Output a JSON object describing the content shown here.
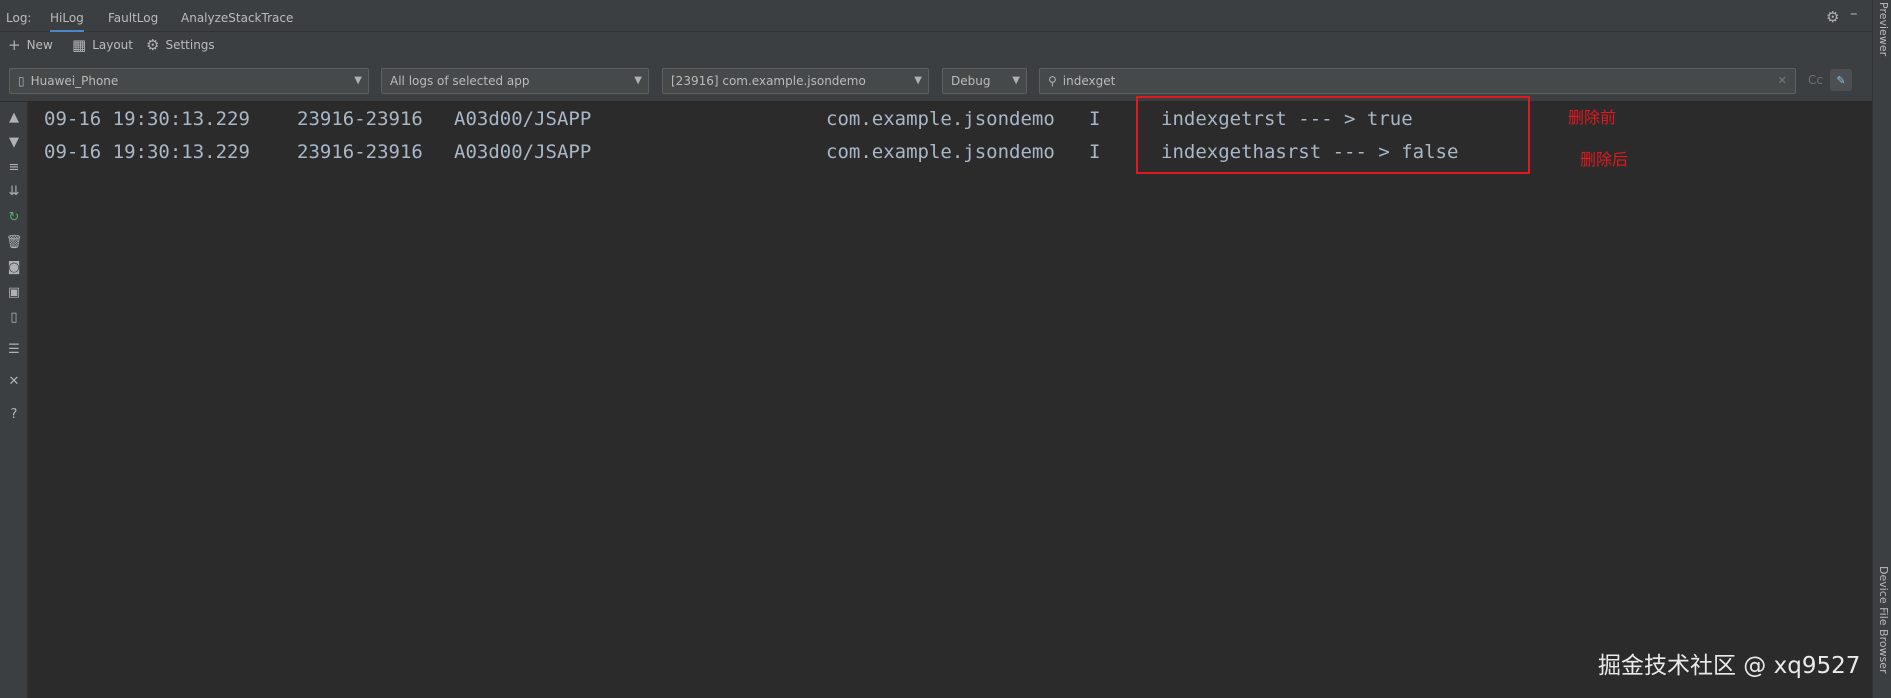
{
  "topbar": {
    "prefix": "Log:",
    "tabs": [
      "HiLog",
      "FaultLog",
      "AnalyzeStackTrace"
    ],
    "active_tab": "HiLog"
  },
  "toolbar": {
    "new_label": "New",
    "layout_label": "Layout",
    "settings_label": "Settings"
  },
  "filters": {
    "device": "Huawei_Phone",
    "scope": "All logs of selected app",
    "process": "[23916] com.example.jsondemo",
    "level": "Debug",
    "search_value": "indexget",
    "case_label": "Cc"
  },
  "log": {
    "rows": [
      {
        "timestamp": "09-16 19:30:13.229",
        "pid": "23916-23916",
        "tag": "A03d00/JSAPP",
        "package": "com.example.jsondemo",
        "level": "I",
        "message": "indexgetrst --- > true"
      },
      {
        "timestamp": "09-16 19:30:13.229",
        "pid": "23916-23916",
        "tag": "A03d00/JSAPP",
        "package": "com.example.jsondemo",
        "level": "I",
        "message": "indexgethasrst --- > false"
      }
    ],
    "annotations": [
      "删除前",
      "删除后"
    ]
  },
  "right_panel": {
    "top_label": "Previewer",
    "bottom_label": "Device File Browser"
  },
  "watermark": "掘金技术社区 @ xq9527",
  "colors": {
    "background": "#2b2b2b",
    "panel": "#3c3f41",
    "log_text": "#a9b7c6",
    "highlight_border": "#e0191f",
    "active_tab_underline": "#4a88c7"
  }
}
